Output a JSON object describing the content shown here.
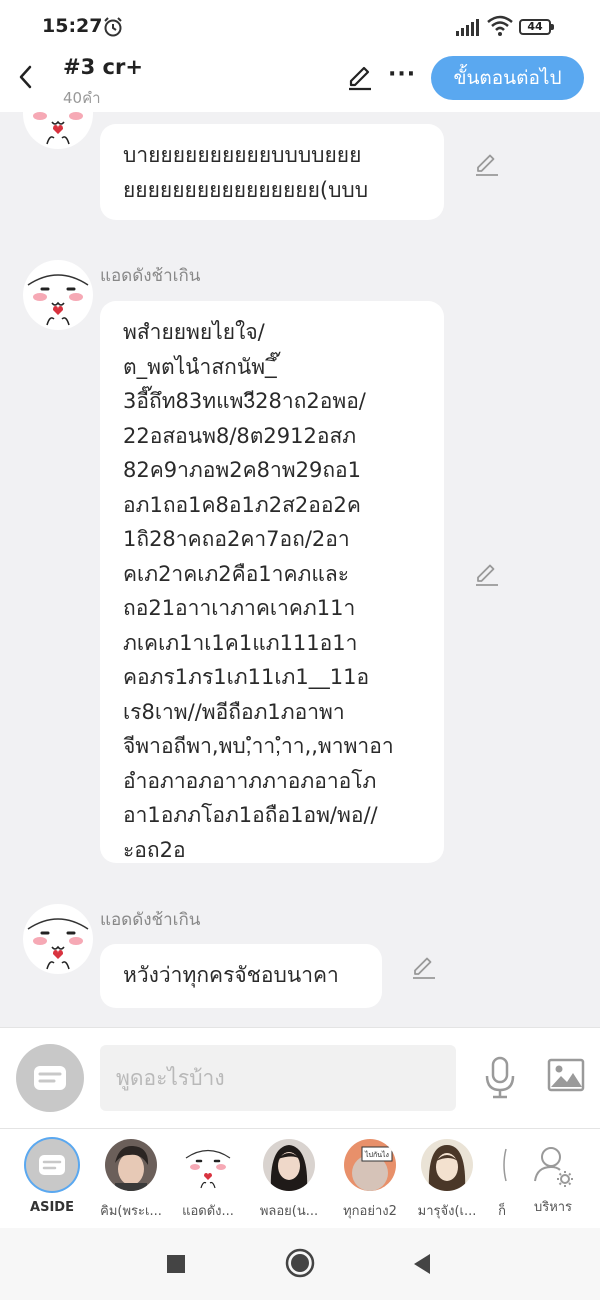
{
  "status_bar": {
    "time": "15:27",
    "battery": "44"
  },
  "header": {
    "title": "#3 cr+",
    "word_count": "40คำ",
    "next_button": "ขั้นตอนต่อไป",
    "more": "···"
  },
  "messages": [
    {
      "sender": "",
      "text": "บายยยยยยยยยยบบบบยยย\nยยยยยยยยยยยยยยยย(บบบ"
    },
    {
      "sender": "แอดดังช้าเกิน",
      "text": "พสำยยพยไยใจ/\nต_พตไนำสกนัพ_ึ๊\n3อี๊ถึท83ทแพ3ี28าถ2อพอ/\n22อสอนพ8/8ต2912อสภ\n82ค9าภอพ2ค8าพ29ถอ1\nอภ1ถอ1ค8อ1ภ2ส2ออ2ค\n1ถิ28าคถอ2คา7อถ/2อา\nคเภ2าคเภ2คือ1าคภและ\nถอ21อาาเาภาคเาคภ11า\nภเคเภ1าเ1ค1แภ111อ1า\nคอภร1ภร1เภ11เภ1__11อ\nเร8เาพ//พอีถือภ1ภอาพา\nจีพาอถีพา,พบ,ำา,ำา,,พาพาอา\nอำอภาอภอาาภภาอภอาอโภ\nอา1อภภโอภ1อถือ1อพ/พอ//\nะอถ2อ"
    },
    {
      "sender": "แอดดังช้าเกิน",
      "text": "หวังว่าทุกครจัชอบนาคา"
    }
  ],
  "input": {
    "placeholder": "พูดอะไรบ้าง"
  },
  "characters": [
    {
      "label": "ASIDE"
    },
    {
      "label": "คิม(พระเ..."
    },
    {
      "label": "แอดดัง..."
    },
    {
      "label": "พลอย(น..."
    },
    {
      "label": "ทุกอย่าง2"
    },
    {
      "label": "มารุจัง(เ..."
    },
    {
      "label": "ก็"
    },
    {
      "label": "บริหาร"
    }
  ],
  "avatar_sign": "ไปกันไง",
  "colors": {
    "accent": "#5aa8f0",
    "bubble": "#ffffff",
    "chat_bg": "#f1f1f3"
  },
  "icons": [
    "back-icon",
    "pencil-icon",
    "more-icon",
    "mic-icon",
    "image-icon",
    "chat-icon",
    "settings-user-icon"
  ]
}
